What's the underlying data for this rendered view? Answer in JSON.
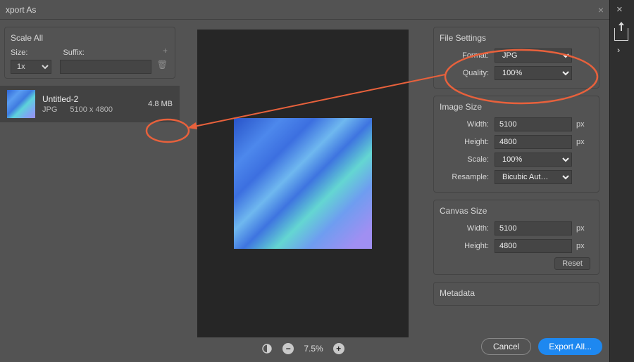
{
  "dialog": {
    "title": "xport As"
  },
  "scale_all": {
    "legend": "Scale All",
    "size_label": "Size:",
    "suffix_label": "Suffix:",
    "size_value": "1x"
  },
  "asset": {
    "name": "Untitled-2",
    "format": "JPG",
    "dimensions": "5100 x 4800",
    "filesize": "4.8 MB"
  },
  "zoom": {
    "percent": "7.5%"
  },
  "file_settings": {
    "legend": "File Settings",
    "format_label": "Format:",
    "format_value": "JPG",
    "quality_label": "Quality:",
    "quality_value": "100%"
  },
  "image_size": {
    "legend": "Image Size",
    "width_label": "Width:",
    "width_value": "5100",
    "height_label": "Height:",
    "height_value": "4800",
    "scale_label": "Scale:",
    "scale_value": "100%",
    "resample_label": "Resample:",
    "resample_value": "Bicubic Aut…",
    "unit": "px"
  },
  "canvas_size": {
    "legend": "Canvas Size",
    "width_label": "Width:",
    "width_value": "5100",
    "height_label": "Height:",
    "height_value": "4800",
    "unit": "px",
    "reset": "Reset"
  },
  "metadata": {
    "legend": "Metadata"
  },
  "footer": {
    "cancel": "Cancel",
    "export": "Export All..."
  },
  "annotation_color": "#e8613c"
}
